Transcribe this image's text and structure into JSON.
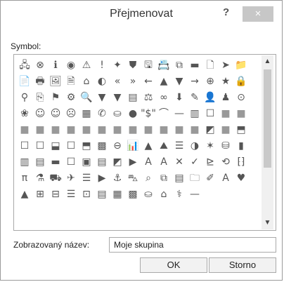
{
  "window": {
    "title": "Přejmenovat",
    "help_glyph": "?",
    "close_glyph": "×"
  },
  "symbol_label": "Symbol:",
  "symbols": [
    "🖧",
    "⊗",
    "ℹ",
    "◉",
    "⚠",
    "!",
    "✦",
    "⛊",
    "🖫",
    "📇",
    "⧉",
    "▬",
    "🗋",
    "➤",
    "📁",
    "📄",
    "🖶",
    "🖼",
    "🗎",
    "⌂",
    "◐",
    "«",
    "»",
    "←",
    "▲",
    "▼",
    "→",
    "⊕",
    "★",
    "🔒",
    "⚲",
    "⎘",
    "⚑",
    "⚙",
    "🔍",
    "▼",
    "▼",
    "▤",
    "⚖",
    "∞",
    "⬇",
    "✎",
    "👤",
    "♟",
    "⊙",
    "❀",
    "☺",
    "☺",
    "☹",
    "▦",
    "✆",
    "⛀",
    "●",
    "\"$\"",
    "⌒",
    "—",
    "▥",
    "☐",
    "■",
    "■",
    "■",
    "■",
    "■",
    "■",
    "■",
    "■",
    "■",
    "■",
    "■",
    "■",
    "■",
    "■",
    "◩",
    "■",
    "⬒",
    "☐",
    "☐",
    "⬓",
    "☐",
    "⬒",
    "▩",
    "⊖",
    "📊",
    "▲",
    "⛰",
    "☰",
    "◑",
    "✶",
    "⛁",
    "▮",
    "▥",
    "▤",
    "▬",
    "☐",
    "▣",
    "▤",
    "◩",
    "▶",
    "A",
    "A",
    "✕",
    "✓",
    "⊵",
    "⟲",
    "⁅⁆",
    "π",
    "⚗",
    "⛟",
    "✈",
    "☰",
    "▶",
    "⚓",
    "⛍",
    "⌕",
    "⧉",
    "▤",
    "🗀",
    "✐",
    "A",
    "♥",
    "▲",
    "⊞",
    "⊟",
    "☰",
    "⊡",
    "▤",
    "▦",
    "▩",
    "⛀",
    "⌂",
    "⚕",
    "—"
  ],
  "display_name": {
    "label": "Zobrazovaný název:",
    "value": "Moje skupina"
  },
  "buttons": {
    "ok": "OK",
    "cancel": "Storno"
  }
}
